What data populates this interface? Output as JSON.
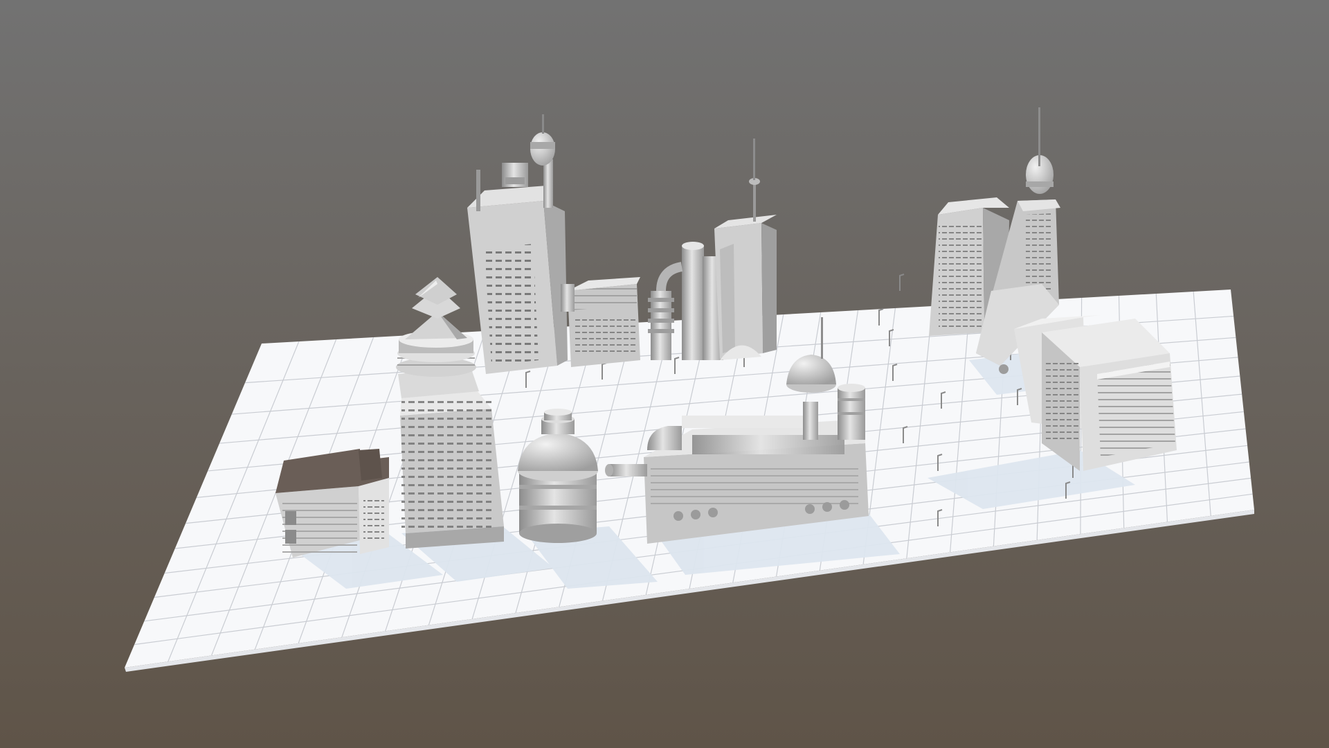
{
  "viewer": {
    "background_top": "#727272",
    "background_bottom": "#5f5448",
    "ground_color": "#f7f8fa",
    "grid_color": "#c9ccd2",
    "building_light": "#dcdcdc",
    "building_mid": "#b9b9b9",
    "building_dark": "#8e8e8e",
    "roof_dark": "#6a5e57",
    "shadow_color": "#dde6ef"
  },
  "scene": {
    "model_name": "",
    "objects": [
      "ground-plane",
      "office-block-brown-roof",
      "stepped-roof-tower",
      "domed-cylinder-building",
      "domed-factory-complex",
      "antenna-tower-complex",
      "pipe-tank-building",
      "tv-tower-block",
      "slab-skyscraper",
      "spire-tower",
      "office-block-right",
      "street-lamps"
    ]
  }
}
